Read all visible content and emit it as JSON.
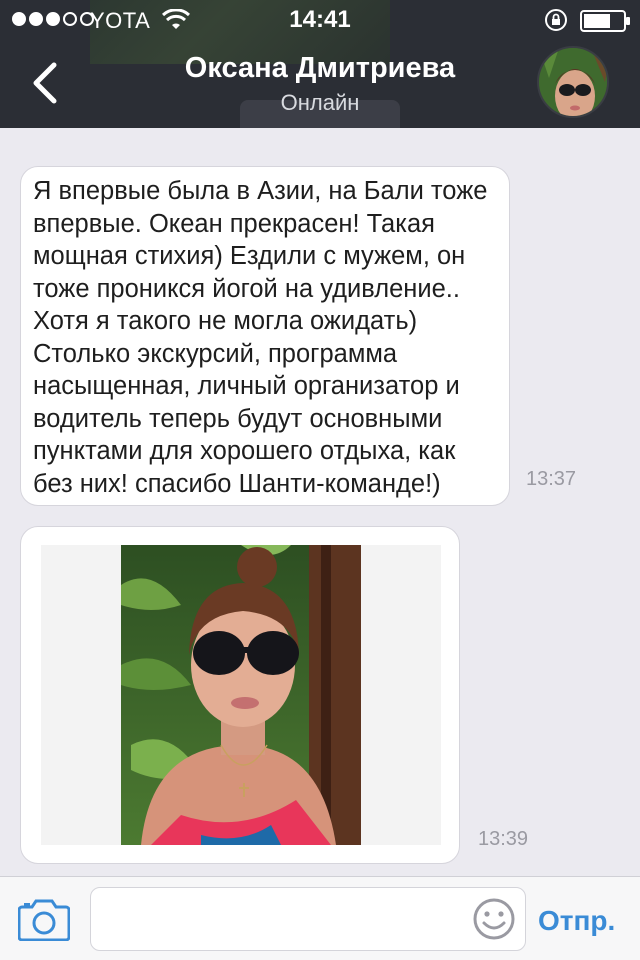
{
  "status_bar": {
    "carrier": "YOTA",
    "time": "14:41",
    "signal_bars": 3,
    "signal_total": 5
  },
  "header": {
    "contact_name": "Оксана Дмитриева",
    "contact_status": "Онлайн",
    "background_color": "#2b2e35"
  },
  "messages": [
    {
      "type": "text",
      "text": "Я впервые была в Азии, на Бали тоже\nвпервые. Океан прекрасен! Такая\nмощная стихия) Ездили с мужем, он\nтоже проникся йогой на удивление..\nХотя я такого не могла ожидать)\nСтолько экскурсий, программа\nнасыщенная, личный организатор и\nводитель теперь будут основными\nпунктами для хорошего отдыха, как\nбез них! спасибо Шанти-команде!)",
      "time": "13:37"
    },
    {
      "type": "photo",
      "time": "13:39"
    }
  ],
  "composer": {
    "input_value": "",
    "input_placeholder": "",
    "send_label": "Отпр.",
    "accent_color": "#3a8bd6"
  },
  "icons": {
    "back": "chevron-left-icon",
    "camera": "camera-icon",
    "emoji": "smiley-icon",
    "wifi": "wifi-icon",
    "lock": "rotation-lock-icon",
    "battery": "battery-icon"
  }
}
